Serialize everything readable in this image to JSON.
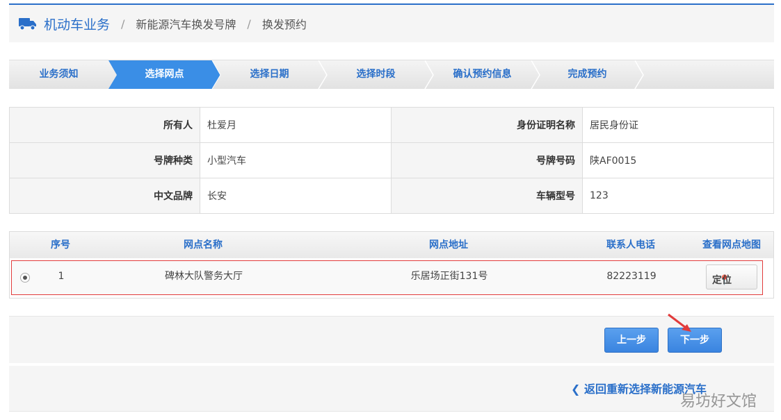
{
  "breadcrumb": {
    "icon": "truck-icon",
    "items": [
      "机动车业务",
      "新能源汽车换发号牌",
      "换发预约"
    ],
    "separator": "/"
  },
  "steps": {
    "items": [
      "业务须知",
      "选择网点",
      "选择日期",
      "选择时段",
      "确认预约信息",
      "完成预约"
    ],
    "active_index": 1,
    "active_color": "#3a8ee6"
  },
  "info": {
    "rows": [
      {
        "k1": "所有人",
        "v1": "杜爱月",
        "k2": "身份证明名称",
        "v2": "居民身份证"
      },
      {
        "k1": "号牌种类",
        "v1": "小型汽车",
        "k2": "号牌号码",
        "v2": "陕AF0015"
      },
      {
        "k1": "中文品牌",
        "v1": "长安",
        "k2": "车辆型号",
        "v2": "123"
      }
    ]
  },
  "outlets": {
    "headers": [
      "序号",
      "网点名称",
      "网点地址",
      "联系人电话",
      "查看网点地图"
    ],
    "rows": [
      {
        "index": "1",
        "name": "碑林大队警务大厅",
        "address": "乐居场正街131号",
        "phone": "82223119",
        "action": "定位",
        "selected": true
      }
    ]
  },
  "actions": {
    "prev": "上一步",
    "next": "下一步"
  },
  "return_link": "返回重新选择新能源汽车",
  "watermark": "易坊好文馆",
  "colors": {
    "brand": "#2a6fc9",
    "highlight": "#e23b3b"
  }
}
